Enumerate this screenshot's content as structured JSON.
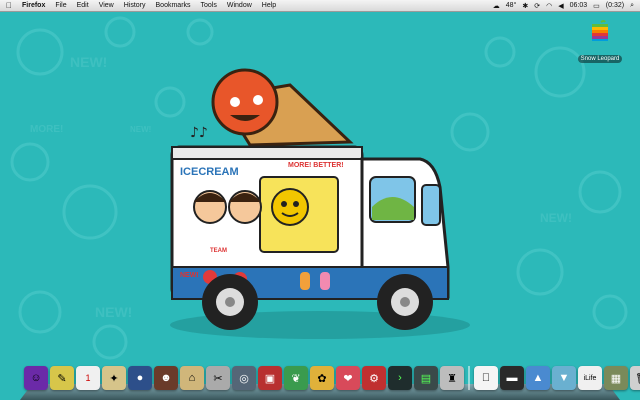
{
  "menubar": {
    "app_name": "Firefox",
    "items": [
      "File",
      "Edit",
      "View",
      "History",
      "Bookmarks",
      "Tools",
      "Window",
      "Help"
    ],
    "status": {
      "temperature": "48°",
      "time": "06:03",
      "battery": "(0:32)"
    }
  },
  "desktop": {
    "drive_label": "Snow Leopard",
    "wallpaper_color": "#2cb9b9",
    "truck_text": {
      "icecream": "ICECREAM",
      "more_better": "MORE! BETTER!",
      "new": "NEW!",
      "team": "TEAM"
    }
  },
  "dock": {
    "items": [
      {
        "icon": "purple-face-icon",
        "color": "#6b2aa8"
      },
      {
        "icon": "notes-icon",
        "color": "#d7c64a"
      },
      {
        "icon": "calendar-icon",
        "color": "#f0f0f0"
      },
      {
        "icon": "compass-icon",
        "color": "#d6c48a"
      },
      {
        "icon": "globe-icon",
        "color": "#2d4f8a"
      },
      {
        "icon": "character-icon",
        "color": "#6a3b2a"
      },
      {
        "icon": "hat-icon",
        "color": "#d0b67a"
      },
      {
        "icon": "tools-icon",
        "color": "#aaaaaa"
      },
      {
        "icon": "radar-icon",
        "color": "#556677"
      },
      {
        "icon": "photo-book-icon",
        "color": "#b83030"
      },
      {
        "icon": "leaf-icon",
        "color": "#3a9b4e"
      },
      {
        "icon": "palette-icon",
        "color": "#e0b13a"
      },
      {
        "icon": "sticker-icon",
        "color": "#d84a5a"
      },
      {
        "icon": "gear-red-icon",
        "color": "#c03030"
      },
      {
        "icon": "terminal-icon",
        "color": "#1f2d2d"
      },
      {
        "icon": "monitor-icon",
        "color": "#3a4a4a"
      },
      {
        "icon": "robot-icon",
        "color": "#bdbdbd"
      },
      {
        "icon": "apple-doc-icon",
        "color": "#f5f5f5"
      },
      {
        "icon": "folder-black-icon",
        "color": "#2a2a2a"
      },
      {
        "icon": "folder-blue-icon",
        "color": "#4a8ad0"
      },
      {
        "icon": "folder-teal-icon",
        "color": "#6ab0d0"
      },
      {
        "icon": "ilife-icon",
        "color": "#f0f0f0"
      },
      {
        "icon": "shelf-icon",
        "color": "#7a8a5a"
      },
      {
        "icon": "trash-icon",
        "color": "#d0d0d0"
      }
    ],
    "labels": {
      "ilife": "iLife"
    }
  }
}
